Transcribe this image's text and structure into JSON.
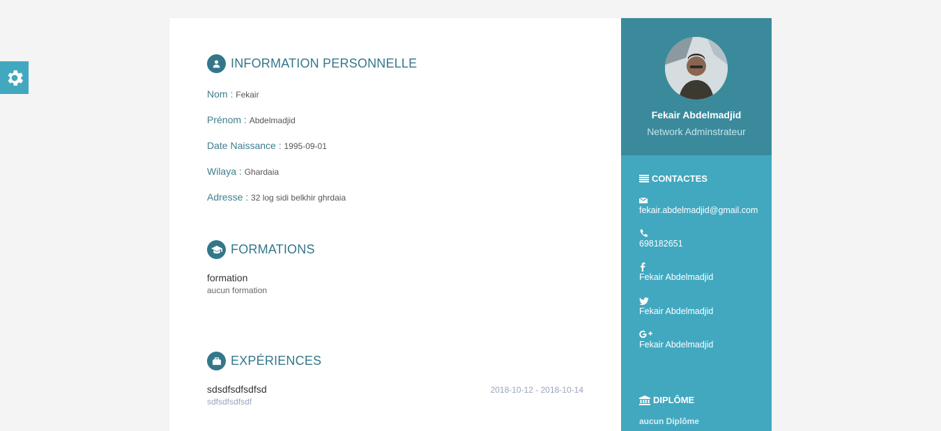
{
  "personal": {
    "heading": "INFORMATION PERSONNELLE",
    "fields": [
      {
        "label": "Nom :",
        "value": "Fekair"
      },
      {
        "label": "Prénom :",
        "value": "Abdelmadjid"
      },
      {
        "label": "Date Naissance :",
        "value": "1995-09-01"
      },
      {
        "label": "Wilaya :",
        "value": "Ghardaia"
      },
      {
        "label": "Adresse :",
        "value": "32 log sidi belkhir ghrdaia"
      }
    ]
  },
  "formations": {
    "heading": "FORMATIONS",
    "items": [
      {
        "title": "formation",
        "subtitle": "aucun formation"
      }
    ]
  },
  "experiences": {
    "heading": "EXPÉRIENCES",
    "items": [
      {
        "title": "sdsdfsdfsdfsd",
        "subtitle": "sdfsdfsdfsdf",
        "dates": "2018-10-12 - 2018-10-14"
      }
    ]
  },
  "profile": {
    "name": "Fekair Abdelmadjid",
    "title": "Network Adminstrateur"
  },
  "contacts": {
    "heading": "CONTACTES",
    "email": "fekair.abdelmadjid@gmail.com",
    "phone": "698182651",
    "facebook": "Fekair Abdelmadjid",
    "twitter": "Fekair Abdelmadjid",
    "googleplus": "Fekair Abdelmadjid"
  },
  "diploma": {
    "heading": "DIPLÔME",
    "value": "aucun Diplôme"
  },
  "colors": {
    "accent": "#33778a",
    "sidebar": "#42a8c0",
    "profile_bg": "#3a8a9c",
    "page_bg": "#f4f4f4"
  },
  "icons": [
    "gear-icon",
    "user-icon",
    "graduation-cap-icon",
    "briefcase-icon",
    "list-icon",
    "envelope-icon",
    "phone-icon",
    "facebook-icon",
    "twitter-icon",
    "google-plus-icon",
    "bank-icon"
  ]
}
